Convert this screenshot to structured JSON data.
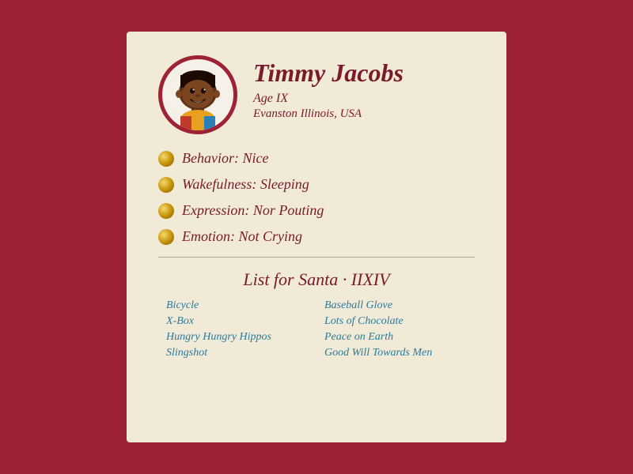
{
  "card": {
    "name": "Timmy Jacobs",
    "age_label": "Age IX",
    "location": "Evanston Illinois, USA",
    "stats": [
      {
        "label": "Behavior: Nice"
      },
      {
        "label": "Wakefulness: Sleeping"
      },
      {
        "label": "Expression: Nor Pouting"
      },
      {
        "label": "Emotion: Not Crying"
      }
    ],
    "list_header": "List for Santa · IIXIV",
    "list_items_left": [
      "Bicycle",
      "X-Box",
      "Hungry Hungry Hippos",
      "Slingshot"
    ],
    "list_items_right": [
      "Baseball Glove",
      "Lots of Chocolate",
      "Peace on Earth",
      "Good Will Towards Men"
    ]
  }
}
